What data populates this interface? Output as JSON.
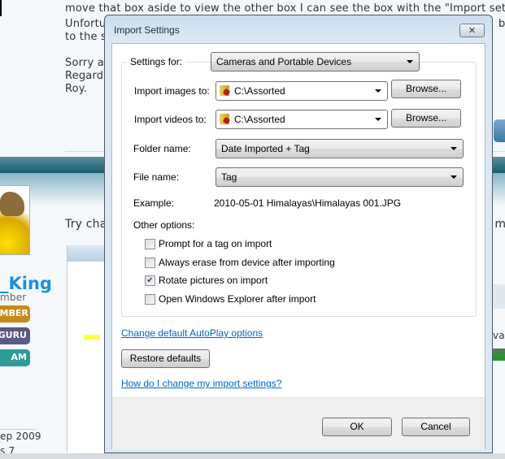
{
  "background": {
    "post_lines": [
      "move that box aside to view the other box I can see the box with the \"Import set",
      "Unfortu",
      "be",
      "to the s",
      "Sorry a",
      "Regards",
      "Roy."
    ],
    "reply_line": "Try cha",
    "reply_right": "t m",
    "right_text": "vab",
    "username": "_King",
    "user_title": "mber",
    "badges": [
      {
        "label": "EMBER",
        "color": "#c88a1a"
      },
      {
        "label": "GURU",
        "color": "#5a5a86"
      },
      {
        "label": "AM",
        "color": "#2e9a9a"
      }
    ],
    "join_date": "ep 2009",
    "os": "s 7"
  },
  "dialog": {
    "title": "Import Settings",
    "close_icon": "close-icon",
    "settings_for_label": "Settings for:",
    "settings_for_value": "Cameras and Portable Devices",
    "import_images_label": "Import images to:",
    "import_images_value": "C:\\Assorted",
    "import_videos_label": "Import videos to:",
    "import_videos_value": "C:\\Assorted",
    "browse_label": "Browse...",
    "folder_name_label": "Folder name:",
    "folder_name_value": "Date Imported + Tag",
    "file_name_label": "File name:",
    "file_name_value": "Tag",
    "example_label": "Example:",
    "example_value": "2010-05-01 Himalayas\\Himalayas 001.JPG",
    "other_options_label": "Other options:",
    "options": [
      {
        "label": "Prompt for a tag on import",
        "checked": false
      },
      {
        "label": "Always erase from device after importing",
        "checked": false
      },
      {
        "label": "Rotate pictures on import",
        "checked": true
      },
      {
        "label": "Open Windows Explorer after import",
        "checked": false
      }
    ],
    "autoplay_link": "Change default AutoPlay options",
    "restore_label": "Restore defaults",
    "help_link": "How do I change my import settings?",
    "ok_label": "OK",
    "cancel_label": "Cancel"
  }
}
